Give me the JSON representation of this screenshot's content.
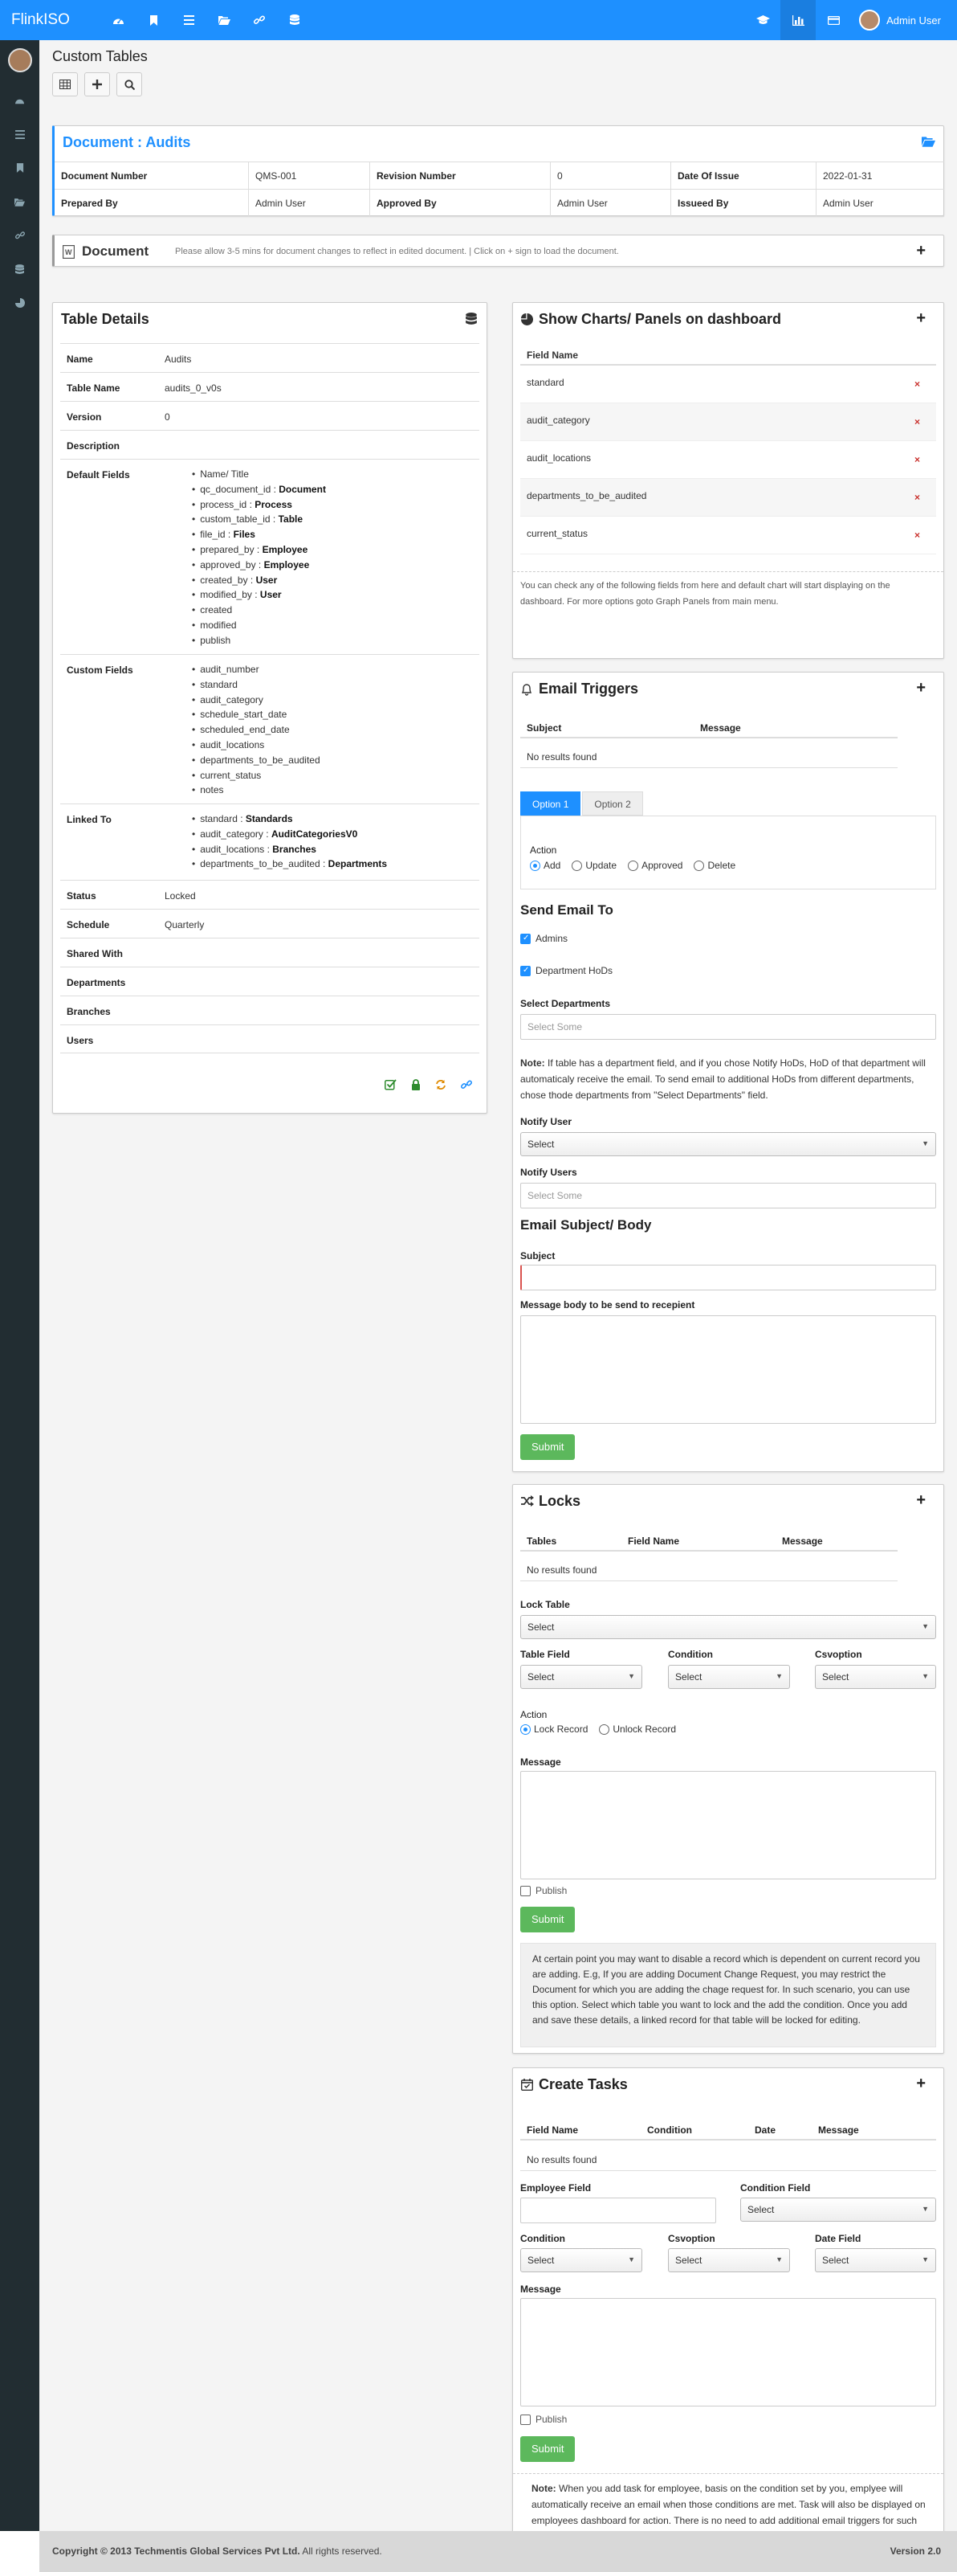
{
  "app": {
    "brand": "FlinkISO",
    "user_name": "Admin User"
  },
  "page": {
    "title": "Custom Tables"
  },
  "document": {
    "title": "Document : Audits",
    "rows": [
      [
        {
          "k": "Document Number"
        },
        {
          "v": "QMS-001"
        },
        {
          "k": "Revision Number"
        },
        {
          "v": "0"
        },
        {
          "k": "Date Of Issue"
        },
        {
          "v": "2022-01-31"
        }
      ],
      [
        {
          "k": "Prepared By"
        },
        {
          "v": "Admin User"
        },
        {
          "k": "Approved By"
        },
        {
          "v": "Admin User"
        },
        {
          "k": "Issueed By"
        },
        {
          "v": "Admin User"
        }
      ]
    ]
  },
  "notice": {
    "title": "Document",
    "text": "Please allow 3-5 mins for document changes to reflect in edited document. | Click on + sign to load the document."
  },
  "table_details": {
    "title": "Table Details",
    "name_label": "Name",
    "name": "Audits",
    "table_name_label": "Table Name",
    "table_name": "audits_0_v0s",
    "version_label": "Version",
    "version": "0",
    "description_label": "Description",
    "default_fields_label": "Default Fields",
    "default_fields": [
      {
        "n": "Name/ Title",
        "t": ""
      },
      {
        "n": "qc_document_id : ",
        "t": "Document"
      },
      {
        "n": "process_id : ",
        "t": "Process"
      },
      {
        "n": "custom_table_id : ",
        "t": "Table"
      },
      {
        "n": "file_id : ",
        "t": "Files"
      },
      {
        "n": "prepared_by : ",
        "t": "Employee"
      },
      {
        "n": "approved_by : ",
        "t": "Employee"
      },
      {
        "n": "created_by : ",
        "t": "User"
      },
      {
        "n": "modified_by : ",
        "t": "User"
      },
      {
        "n": "created",
        "t": ""
      },
      {
        "n": "modified",
        "t": ""
      },
      {
        "n": "publish",
        "t": ""
      }
    ],
    "custom_fields_label": "Custom Fields",
    "custom_fields": [
      "audit_number",
      "standard",
      "audit_category",
      "schedule_start_date",
      "scheduled_end_date",
      "audit_locations",
      "departments_to_be_audited",
      "current_status",
      "notes"
    ],
    "linked_to_label": "Linked To",
    "linked_to": [
      {
        "n": "standard : ",
        "t": "Standards"
      },
      {
        "n": "audit_category : ",
        "t": "AuditCategoriesV0"
      },
      {
        "n": "audit_locations : ",
        "t": "Branches"
      },
      {
        "n": "departments_to_be_audited : ",
        "t": "Departments"
      }
    ],
    "status_label": "Status",
    "status": "Locked",
    "schedule_label": "Schedule",
    "schedule": "Quarterly",
    "shared_with_label": "Shared With",
    "departments_label": "Departments",
    "branches_label": "Branches",
    "users_label": "Users"
  },
  "charts_panel": {
    "title": "Show Charts/ Panels on dashboard",
    "field_name_header": "Field Name",
    "fields": [
      "standard",
      "audit_category",
      "audit_locations",
      "departments_to_be_audited",
      "current_status"
    ],
    "help": "You can check any of the following fields from here and default chart will start displaying on the dashboard. For more options goto Graph Panels from main menu."
  },
  "email_triggers": {
    "title": "Email Triggers",
    "col_subject": "Subject",
    "col_message": "Message",
    "no_results": "No results found",
    "tab1": "Option 1",
    "tab2": "Option 2",
    "action_label": "Action",
    "actions": [
      "Add",
      "Update",
      "Approved",
      "Delete"
    ],
    "send_to_title": "Send Email To",
    "admins": "Admins",
    "dept_hods": "Department HoDs",
    "select_departments_label": "Select Departments",
    "select_some": "Select Some",
    "note_bold": "Note:",
    "note": " If table has a department field, and if you chose Notify HoDs, HoD of that department will automaticaly receive the email. To send email to additional HoDs from different departments, chose thode departments from \"Select Departments\" field.",
    "notify_user_label": "Notify User",
    "select": "Select",
    "notify_users_label": "Notify Users",
    "subject_body_title": "Email Subject/ Body",
    "subject_label": "Subject",
    "message_label": "Message body to be send to recepient",
    "submit": "Submit"
  },
  "locks": {
    "title": "Locks",
    "col_tables": "Tables",
    "col_field_name": "Field Name",
    "col_message": "Message",
    "no_results": "No results found",
    "lock_table_label": "Lock Table",
    "table_field_label": "Table Field",
    "condition_label": "Condition",
    "csvoption_label": "Csvoption",
    "select": "Select",
    "action_label": "Action",
    "lock_record": "Lock Record",
    "unlock_record": "Unlock Record",
    "message_label": "Message",
    "publish": "Publish",
    "submit": "Submit",
    "note": "At certain point you may want to disable a record which is dependent on current record you are adding. E.g, If you are adding Document Change Request, you may restrict the Document for which you are adding the chage request for. In such scenario, you can use this option. Select which table you want to lock and the add the condition. Once you add and save these details, a linked record for that table will be locked for editing."
  },
  "tasks": {
    "title": "Create Tasks",
    "col_field_name": "Field Name",
    "col_condition": "Condition",
    "col_date": "Date",
    "col_message": "Message",
    "no_results": "No results found",
    "employee_field_label": "Employee Field",
    "condition_field_label": "Condition Field",
    "condition_label": "Condition",
    "csvoption_label": "Csvoption",
    "date_field_label": "Date Field",
    "select": "Select",
    "message_label": "Message",
    "publish": "Publish",
    "submit": "Submit",
    "note_bold": "Note:",
    "note": " When you add task for employee, basis on the condition set by you, emplyee will automatically receive an email when those conditions are met. Task will also be displayed on employees dashboard for action. There is no need to add additional email triggers for such conditions."
  },
  "footer": {
    "copyright": "Copyright © 2013 Techmentis Global Services Pvt Ltd.",
    "rights": " All rights reserved.",
    "version": "Version 2.0"
  }
}
